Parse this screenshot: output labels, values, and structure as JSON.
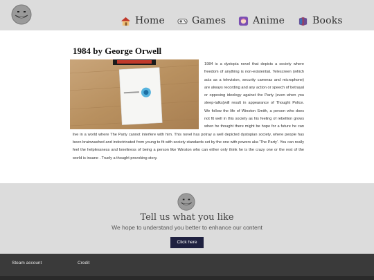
{
  "nav": {
    "items": [
      {
        "label": "Home",
        "icon": "house-icon"
      },
      {
        "label": "Games",
        "icon": "game-controller-icon"
      },
      {
        "label": "Anime",
        "icon": "anime-character-icon"
      },
      {
        "label": "Books",
        "icon": "book-icon"
      }
    ]
  },
  "article": {
    "title": "1984 by George Orwell",
    "body": "1984 is a dystopia novel that depicts a society where freedom of anything is non-existential. Telescreen (which acts as a television, security cameras and microphone) are always recording and any action or speech of betrayal or opposing ideology against the Party (even when you sleep-talks)will result in appearance of Thought Police. We follow the life of Winston Smith, a person who does not fit well in this society as his feeling of rebellion grows when he thought there might be hope for a future he can live in a world where The Party cannot interfere with him. This novel has potray a well depicted dystopian society, where people has been brainwashed and indoctrinated from young to fit with society standards set by the one with powers aka 'The Party'. You can really feel the helplessness and loneliness of being a person like Winston who can either only think he is the crazy one or the rest of the world is insane . Truely a thought provoking story."
  },
  "cta": {
    "title": "Tell us what you like",
    "subtitle": "We hope to understand you better to enhance our content",
    "button_label": "Click here"
  },
  "footer": {
    "links": [
      {
        "label": "Steam account"
      },
      {
        "label": "Credit"
      }
    ]
  },
  "colors": {
    "header_bg": "#dcdcdc",
    "button_bg": "#1f2140",
    "footer_bg": "#3a3a3a"
  }
}
